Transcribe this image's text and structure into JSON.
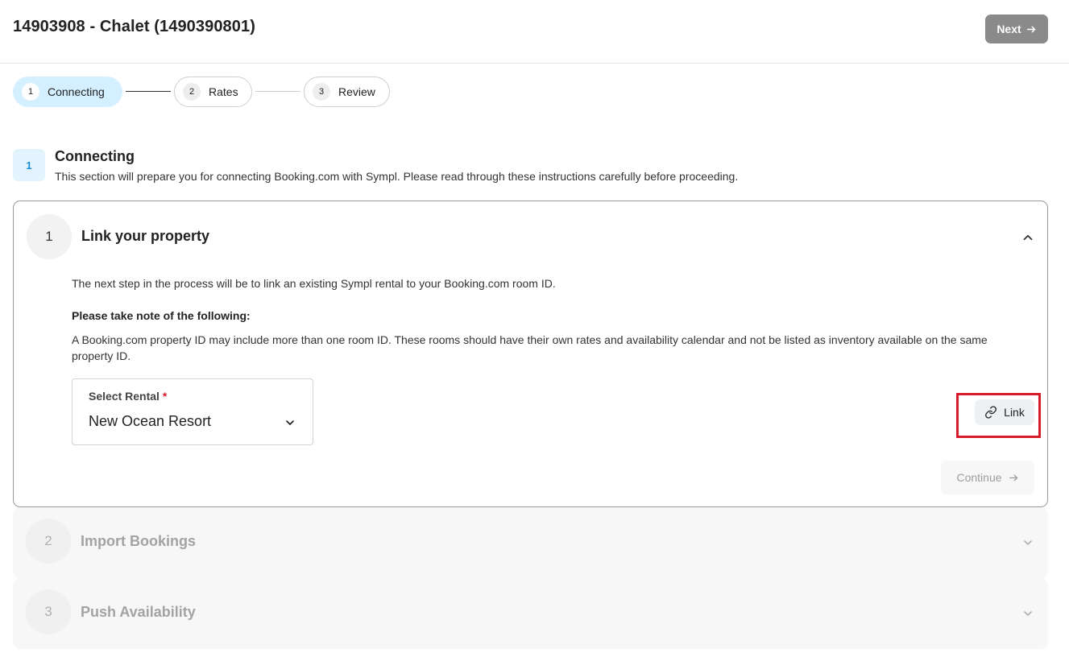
{
  "header": {
    "title": "14903908 - Chalet (1490390801)",
    "next_label": "Next"
  },
  "stepper": [
    {
      "number": "1",
      "label": "Connecting",
      "active": true
    },
    {
      "number": "2",
      "label": "Rates",
      "active": false
    },
    {
      "number": "3",
      "label": "Review",
      "active": false
    }
  ],
  "section": {
    "number": "1",
    "title": "Connecting",
    "description": "This section will prepare you for connecting Booking.com with Sympl. Please read through these instructions carefully before proceeding."
  },
  "link_property": {
    "number": "1",
    "title": "Link your property",
    "intro": "The next step in the process will be to link an existing Sympl rental to your Booking.com room ID.",
    "note_title": "Please take note of the following:",
    "note_text": "A Booking.com property ID may include more than one room ID. These rooms should have their own rates and availability calendar and not be listed as inventory available on the same property ID.",
    "select_label": "Select Rental",
    "required_mark": "*",
    "select_value": "New Ocean Resort",
    "link_label": "Link",
    "continue_label": "Continue"
  },
  "collapsed_panels": [
    {
      "number": "2",
      "title": "Import Bookings"
    },
    {
      "number": "3",
      "title": "Push Availability"
    }
  ],
  "colors": {
    "active_step_bg": "#d4efff",
    "highlight": "#d81b2b",
    "next_button_bg": "#8a8a8a",
    "required": "#d81b2b"
  },
  "icons": {
    "next": "arrow-right-icon",
    "collapse": "chevron-up-icon",
    "select": "chevron-down-icon",
    "link": "link-icon",
    "continue": "arrow-right-icon",
    "expand": "chevron-down-icon"
  }
}
